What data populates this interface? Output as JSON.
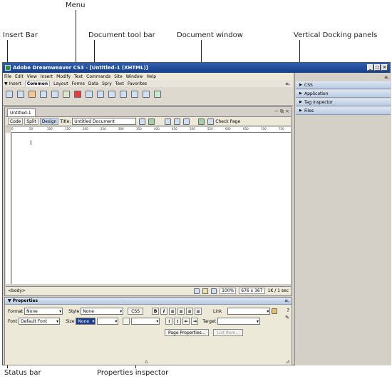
{
  "annotations": {
    "menu": "Menu",
    "insert_bar": "Insert Bar",
    "document_toolbar": "Document tool bar",
    "document_window": "Document window",
    "vertical_docking": "Vertical Docking panels",
    "status_bar": "Status bar",
    "properties_inspector": "Properties inspector"
  },
  "window": {
    "title": "Adobe Dreamweaver CS3 - [Untitled-1 (XHTML)]",
    "min": "_",
    "max": "□",
    "close": "×"
  },
  "menubar": [
    "File",
    "Edit",
    "View",
    "Insert",
    "Modify",
    "Text",
    "Commands",
    "Site",
    "Window",
    "Help"
  ],
  "insertbar": {
    "label": "▼ Insert",
    "tabs": [
      "Common",
      "Layout",
      "Forms",
      "Data",
      "Spry",
      "Text",
      "Favorites"
    ],
    "menu_glyph": "≡,"
  },
  "dock": {
    "menu_glyph": "≡,",
    "panels": [
      "CSS",
      "Application",
      "Tag Inspector",
      "Files"
    ]
  },
  "document": {
    "tab": "Untitled-1",
    "controls": "− ⧉ ×",
    "code": "Code",
    "split": "Split",
    "design": "Design",
    "title_label": "Title:",
    "title_value": "Untitled Document",
    "check_page": "Check Page",
    "ruler": [
      "0",
      "50",
      "100",
      "150",
      "200",
      "250",
      "300",
      "350",
      "400",
      "450",
      "500",
      "550",
      "600",
      "650",
      "700",
      "750"
    ],
    "cursor": "I"
  },
  "status": {
    "tag": "<body>",
    "zoom": "100%",
    "size": "676 x 367",
    "download": "1K / 1 sec"
  },
  "properties": {
    "header": "▼ Properties",
    "format_label": "Format",
    "format_value": "None",
    "style_label": "Style",
    "style_value": "None",
    "css_button": "CSS",
    "bold": "B",
    "italic": "I",
    "link_label": "Link",
    "font_label": "Font",
    "font_value": "Default Font",
    "size_label": "Size",
    "size_value": "None",
    "target_label": "Target",
    "page_properties": "Page Properties...",
    "list_item": "List Item..."
  }
}
